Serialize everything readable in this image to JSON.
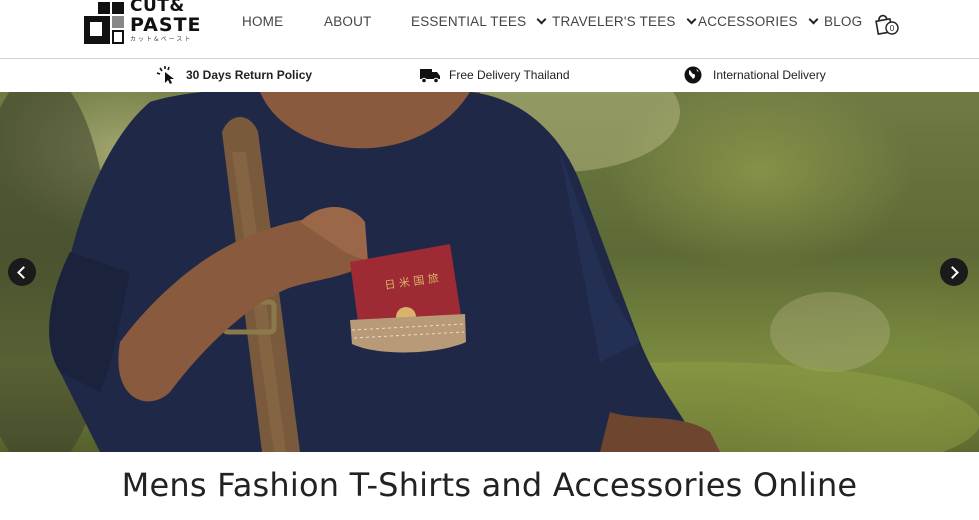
{
  "logo": {
    "line1": "CUT&",
    "line2": "PASTE",
    "line3": "カット&ペースト"
  },
  "nav": {
    "items": [
      {
        "label": "HOME",
        "dropdown": false
      },
      {
        "label": "ABOUT",
        "dropdown": false
      },
      {
        "label": "ESSENTIAL TEES",
        "dropdown": true
      },
      {
        "label": "TRAVELER'S TEES",
        "dropdown": true
      },
      {
        "label": "ACCESSORIES",
        "dropdown": true
      },
      {
        "label": "BLOG",
        "dropdown": false
      }
    ],
    "cart_count": "0"
  },
  "usp": {
    "return": {
      "label": "30 Days Return Policy",
      "icon": "cursor-click-icon"
    },
    "delivery": {
      "label": "Free Delivery Thailand",
      "icon": "truck-icon"
    },
    "international": {
      "label": "International Delivery",
      "icon": "globe-icon"
    }
  },
  "hero": {
    "passport_text": "日 米 国 旅",
    "prev_icon": "chevron-left-icon",
    "next_icon": "chevron-right-icon"
  },
  "headline": "Mens Fashion T-Shirts and Accessories Online",
  "colors": {
    "shirt": "#1f2947",
    "strap": "#7a5a3c",
    "passport": "#9e2a34",
    "arrow_bg": "#1a1a1a"
  }
}
